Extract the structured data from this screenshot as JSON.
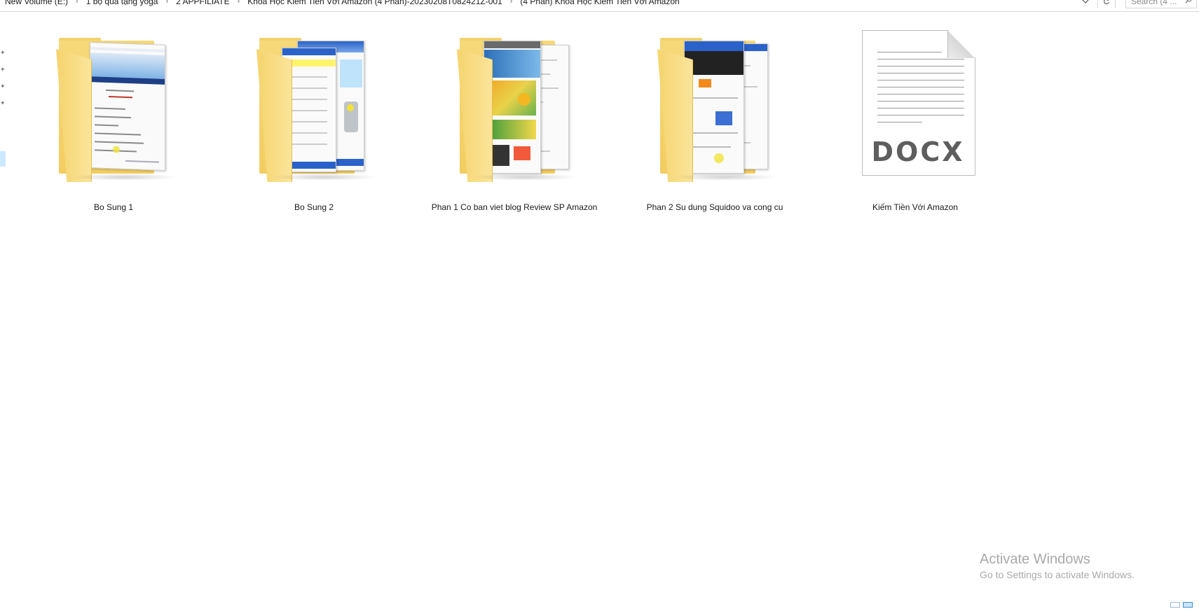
{
  "address_bar": {
    "breadcrumbs": [
      "New Volume (E:)",
      "1 bộ quà tặng yoga",
      "2 APPFILIATE",
      "Khóa Học Kiếm Tiền Với Amazon (4 Phần)-20230208T082421Z-001",
      "(4 Phần) Khóa Học Kiếm Tiền Với Amazon"
    ],
    "separator": "›",
    "dropdown_icon": "chevron-down-icon",
    "refresh_icon": "refresh-icon",
    "search_placeholder": "Search (4 ..."
  },
  "items": [
    {
      "type": "folder",
      "name": "Bo Sung 1",
      "preview": "blue-header-list"
    },
    {
      "type": "folder",
      "name": "Bo Sung 2",
      "preview": "spreadsheet-product"
    },
    {
      "type": "folder",
      "name": "Phan 1 Co ban viet blog Review SP Amazon",
      "preview": "colorful-web-page"
    },
    {
      "type": "folder",
      "name": "Phan 2 Su dung Squidoo va cong cu",
      "preview": "dark-web-page"
    },
    {
      "type": "file",
      "name": "Kiếm Tiền Với Amazon",
      "icon_text": "DOCX"
    }
  ],
  "watermark": {
    "title": "Activate Windows",
    "subtitle": "Go to Settings to activate Windows."
  },
  "colors": {
    "folder": "#f2cd60",
    "selection": "#cce8ff",
    "watermark": "#a9a9a9"
  }
}
